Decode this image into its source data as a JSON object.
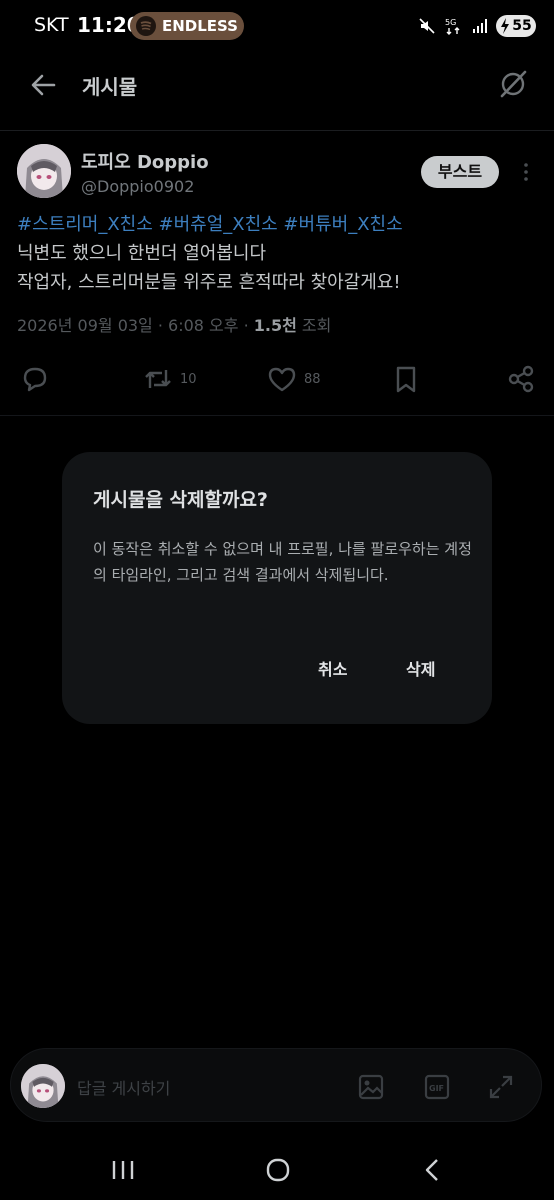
{
  "status_bar": {
    "carrier": "SKT",
    "time": "11:20",
    "media_label": "ENDLESS",
    "battery": "55",
    "network": "5G"
  },
  "header": {
    "title": "게시물"
  },
  "post": {
    "author_name": "도피오 Doppio",
    "author_handle": "@Doppio0902",
    "boost_label": "부스트",
    "hashtags": "#스트리머_X친소 #버츄얼_X친소 #버튜버_X친소",
    "line1": "닉변도 했으니 한번더 열어봅니다",
    "line2": "작업자, 스트리머분들 위주로 흔적따라 찾아갈게요!",
    "date": "2026년 09월 03일 · 6:08 오후 · ",
    "views_count": "1.5천",
    "views_label": " 조회",
    "retweet_count": "10",
    "like_count": "88"
  },
  "dialog": {
    "title": "게시물을 삭제할까요?",
    "text": "이 동작은 취소할 수 없으며 내 프로필, 나를 팔로우하는 계정의 타임라인, 그리고 검색 결과에서 삭제됩니다.",
    "cancel_label": "취소",
    "delete_label": "삭제"
  },
  "reply": {
    "placeholder": "답글 게시하기",
    "gif_label": "GIF"
  },
  "icons": {
    "back": "arrow-left-icon",
    "grok": "grok-icon",
    "reply": "comment-icon",
    "retweet": "retweet-icon",
    "like": "heart-icon",
    "bookmark": "bookmark-icon",
    "share": "share-icon",
    "image": "image-icon",
    "gif": "gif-icon",
    "expand": "expand-icon"
  }
}
